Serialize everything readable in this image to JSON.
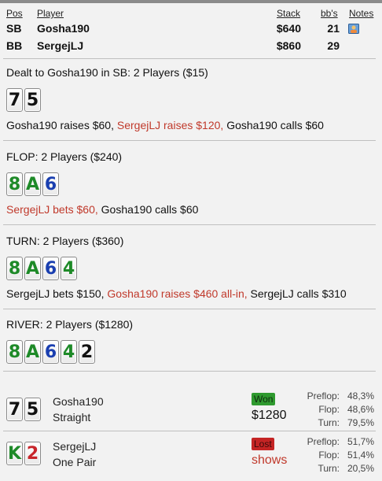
{
  "header": {
    "pos": "Pos",
    "player": "Player",
    "stack": "Stack",
    "bbs": "bb's",
    "notes": "Notes"
  },
  "players": [
    {
      "pos": "SB",
      "name": "Gosha190",
      "stack": "$640",
      "bbs": "21"
    },
    {
      "pos": "BB",
      "name": "SergejLJ",
      "stack": "$860",
      "bbs": "29"
    }
  ],
  "preflop": {
    "title": "Dealt to Gosha190 in SB: 2 Players ($15)",
    "cards": [
      {
        "rank": "7",
        "suit": "spades"
      },
      {
        "rank": "5",
        "suit": "spades"
      }
    ],
    "actions": [
      {
        "text": "Gosha190 raises $60, ",
        "hero": false
      },
      {
        "text": "SergejLJ raises $120, ",
        "hero": true
      },
      {
        "text": "Gosha190 calls $60",
        "hero": false
      }
    ]
  },
  "flop": {
    "title": "FLOP: 2 Players ($240)",
    "cards": [
      {
        "rank": "8",
        "suit": "clubs"
      },
      {
        "rank": "A",
        "suit": "clubs"
      },
      {
        "rank": "6",
        "suit": "diamonds"
      }
    ],
    "actions": [
      {
        "text": "SergejLJ bets $60, ",
        "hero": true
      },
      {
        "text": "Gosha190 calls $60",
        "hero": false
      }
    ]
  },
  "turn": {
    "title": "TURN: 2 Players ($360)",
    "cards": [
      {
        "rank": "8",
        "suit": "clubs"
      },
      {
        "rank": "A",
        "suit": "clubs"
      },
      {
        "rank": "6",
        "suit": "diamonds"
      },
      {
        "rank": "4",
        "suit": "clubs"
      }
    ],
    "actions": [
      {
        "text": "SergejLJ bets $150, ",
        "hero": false
      },
      {
        "text": "Gosha190 raises $460 all-in, ",
        "hero": true
      },
      {
        "text": "SergejLJ calls $310",
        "hero": false
      }
    ]
  },
  "river": {
    "title": "RIVER: 2 Players ($1280)",
    "cards": [
      {
        "rank": "8",
        "suit": "clubs"
      },
      {
        "rank": "A",
        "suit": "clubs"
      },
      {
        "rank": "6",
        "suit": "diamonds"
      },
      {
        "rank": "4",
        "suit": "clubs"
      },
      {
        "rank": "2",
        "suit": "spades"
      }
    ]
  },
  "results": [
    {
      "cards": [
        {
          "rank": "7",
          "suit": "spades"
        },
        {
          "rank": "5",
          "suit": "spades"
        }
      ],
      "name": "Gosha190",
      "hand": "Straight",
      "status": "Won",
      "amount": "$1280",
      "equity": [
        {
          "street": "Preflop:",
          "value": "48,3%"
        },
        {
          "street": "Flop:",
          "value": "48,6%"
        },
        {
          "street": "Turn:",
          "value": "79,5%"
        }
      ]
    },
    {
      "cards": [
        {
          "rank": "K",
          "suit": "clubs"
        },
        {
          "rank": "2",
          "suit": "hearts"
        }
      ],
      "name": "SergejLJ",
      "hand": "One Pair",
      "status": "Lost",
      "amount": "shows",
      "equity": [
        {
          "street": "Preflop:",
          "value": "51,7%"
        },
        {
          "street": "Flop:",
          "value": "51,4%"
        },
        {
          "street": "Turn:",
          "value": "20,5%"
        }
      ]
    }
  ],
  "colors": {
    "action_highlight": "#c0392b",
    "won": "#2f9a2f",
    "lost": "#c42424"
  }
}
